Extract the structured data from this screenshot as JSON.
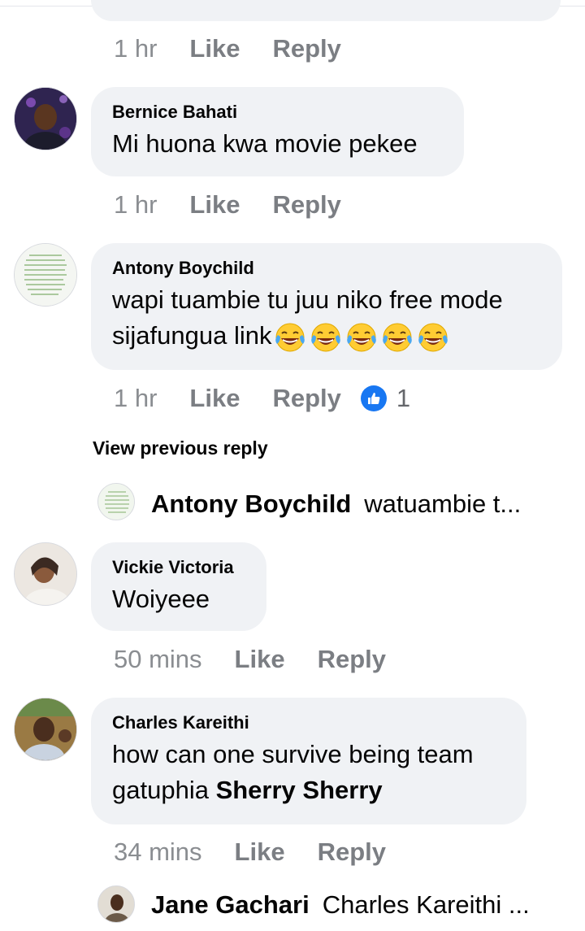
{
  "previous_comment": {
    "time": "1 hr",
    "like": "Like",
    "reply": "Reply"
  },
  "comments": [
    {
      "author": "Bernice Bahati",
      "text": "Mi huona kwa movie pekee",
      "time": "1 hr",
      "like": "Like",
      "reply": "Reply"
    },
    {
      "author": "Antony Boychild",
      "text_line1": "wapi tuambie tu juu niko free mode",
      "text_line2": "sijafungua link",
      "emojis": [
        "face-with-tears-of-joy-icon",
        "face-with-tears-of-joy-icon",
        "face-with-tears-of-joy-icon",
        "face-with-tears-of-joy-icon",
        "face-with-tears-of-joy-icon"
      ],
      "time": "1 hr",
      "like": "Like",
      "reply": "Reply",
      "reaction_count": "1",
      "view_previous": "View previous reply",
      "reply_preview": {
        "author": "Antony Boychild",
        "text": "watuambie t..."
      }
    },
    {
      "author": "Vickie Victoria",
      "text": "Woiyeee",
      "time": "50 mins",
      "like": "Like",
      "reply": "Reply"
    },
    {
      "author": "Charles Kareithi",
      "text_line1": "how can one survive being team",
      "text_line2_plain": "gatuphia ",
      "text_line2_bold": "Sherry Sherry",
      "time": "34 mins",
      "like": "Like",
      "reply": "Reply",
      "reply_preview": {
        "author": "Jane Gachari",
        "text": "Charles Kareithi ..."
      }
    }
  ],
  "colors": {
    "bubble": "#f0f2f5",
    "meta_text": "#65676b",
    "like_blue": "#1877f2",
    "emoji_yellow": "#ffcc33"
  }
}
